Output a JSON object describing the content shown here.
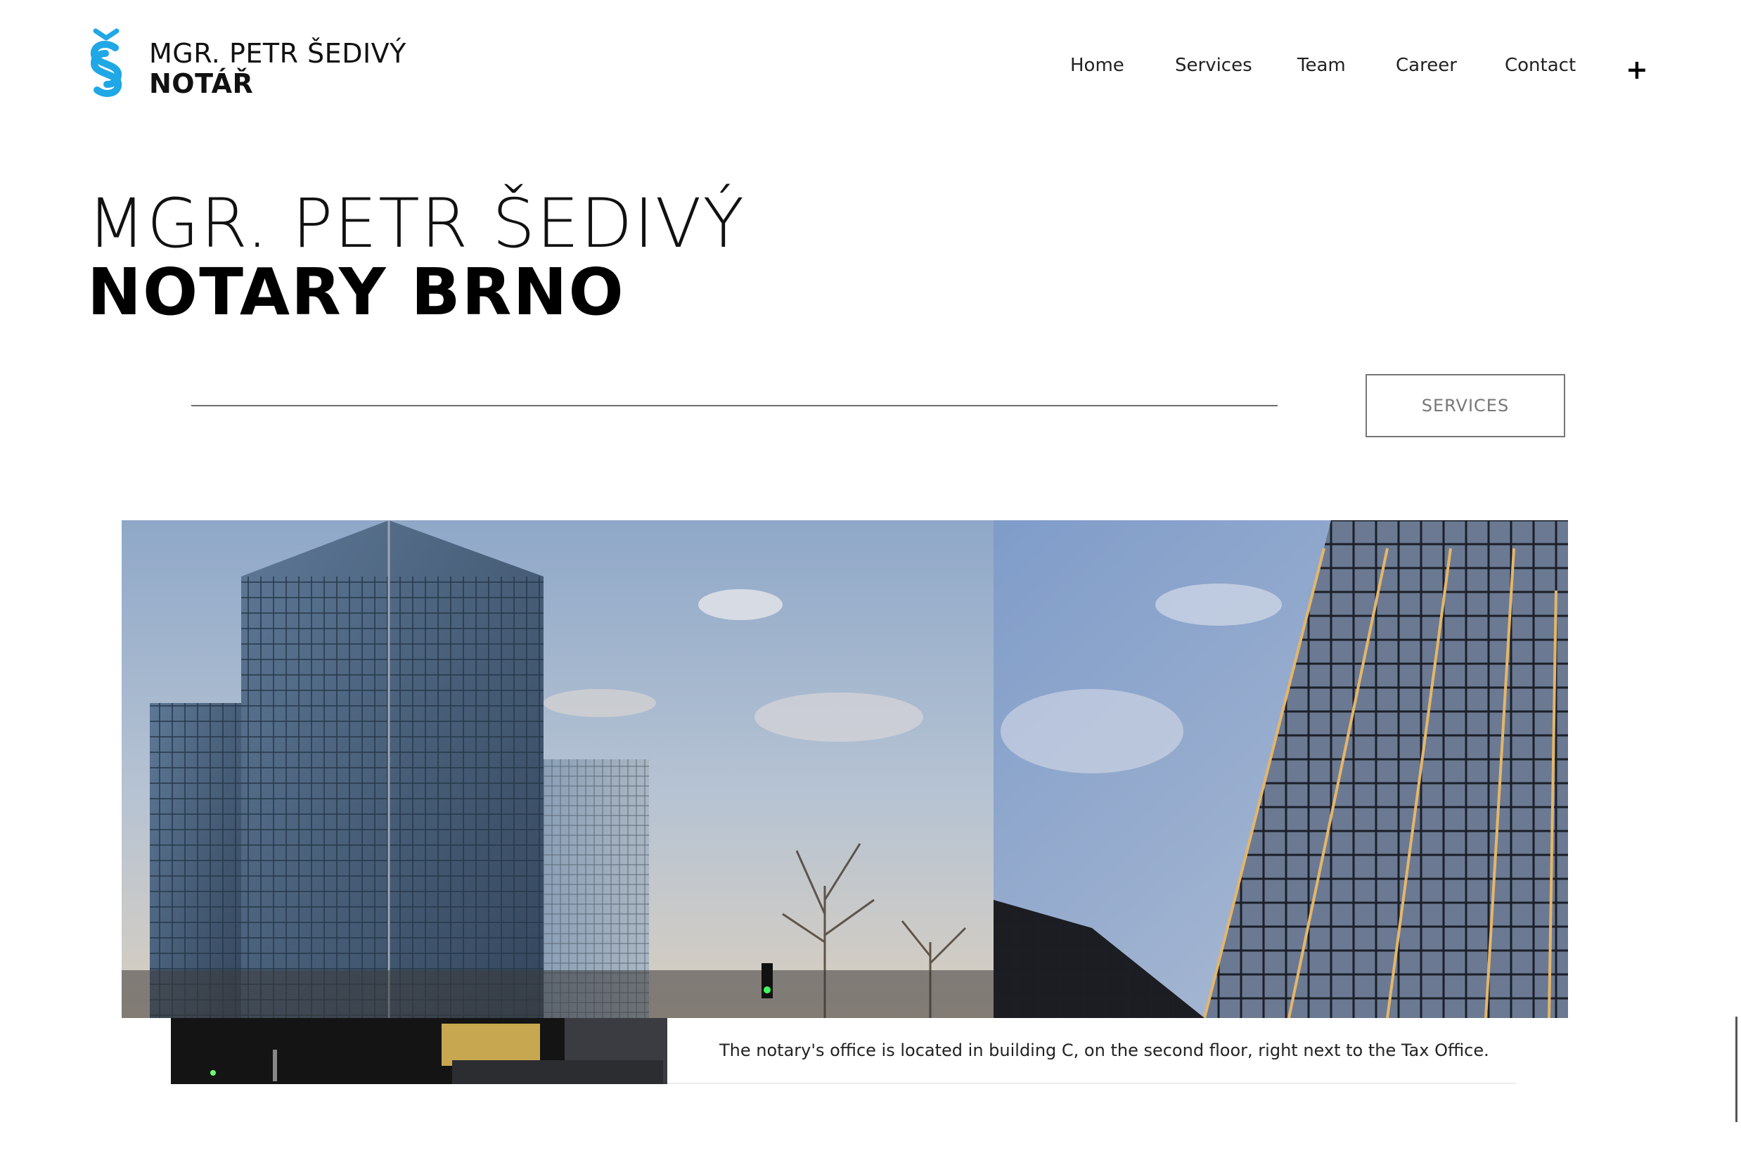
{
  "brand": {
    "line1": "MGR. PETR ŠEDIVÝ",
    "line2": "NOTÁŘ",
    "mark_icon": "section-sign-logo-icon",
    "accent_color": "#1fa8e5"
  },
  "nav": {
    "items": [
      {
        "label": "Home"
      },
      {
        "label": "Services"
      },
      {
        "label": "Team"
      },
      {
        "label": "Career"
      },
      {
        "label": "Contact"
      }
    ],
    "plus_label": "+"
  },
  "hero": {
    "title_line1": "MGR. PETR ŠEDIVÝ",
    "title_line2": "NOTARY BRNO",
    "services_button": "SERVICES"
  },
  "gallery": {
    "caption": "The notary's office is located in building C, on the second floor, right next to the Tax Office."
  }
}
